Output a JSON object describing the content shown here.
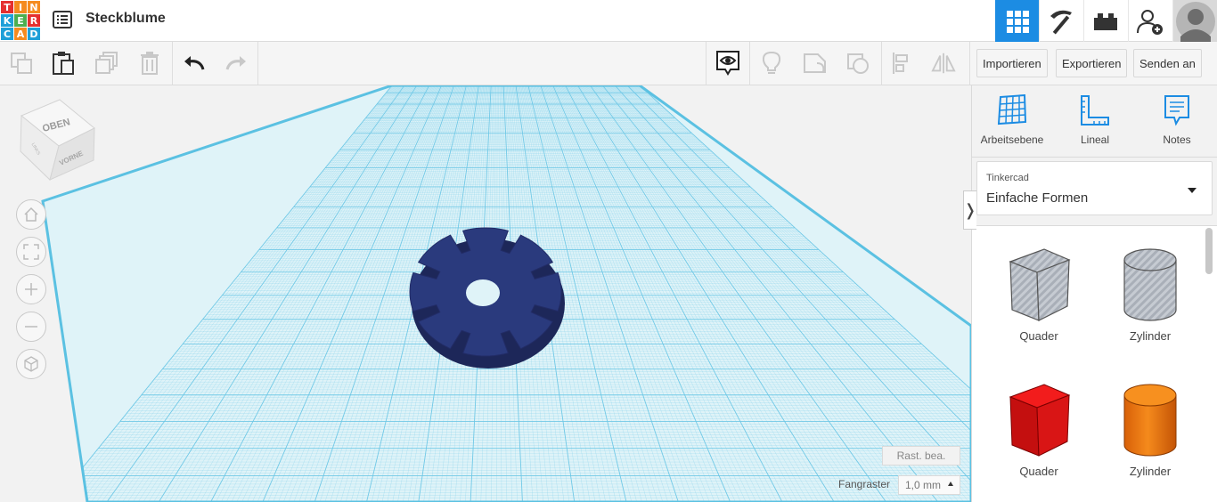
{
  "app": {
    "logo_letters": [
      "T",
      "I",
      "N",
      "K",
      "E",
      "R",
      "C",
      "A",
      "D"
    ],
    "project_title": "Steckblume"
  },
  "top_nav": {
    "views": [
      "3d-design-view",
      "build-view",
      "bricks-view"
    ],
    "active_view": "3d-design-view",
    "accent_color": "#1c8ce3"
  },
  "toolbar": {
    "import_label": "Importieren",
    "export_label": "Exportieren",
    "send_label": "Senden an",
    "undo_enabled": true,
    "redo_enabled": false
  },
  "view_cube": {
    "top_label": "OBEN",
    "front_label": "VORNE",
    "left_label": "LINKS"
  },
  "canvas": {
    "edit_grid_label": "Rast. bea.",
    "snap_grid_label": "Fangraster",
    "snap_grid_value": "1,0 mm",
    "grid_color": "#6cc7e6",
    "object_color": "#2a3a7d"
  },
  "right_panel": {
    "tools": [
      {
        "label": "Arbeitsebene",
        "icon": "workplane-icon"
      },
      {
        "label": "Lineal",
        "icon": "ruler-icon"
      },
      {
        "label": "Notes",
        "icon": "notes-icon"
      }
    ],
    "library_source": "Tinkercad",
    "library_name": "Einfache Formen",
    "shapes": [
      {
        "label": "Quader",
        "icon": "box-hole-icon",
        "color": "#b9bec6"
      },
      {
        "label": "Zylinder",
        "icon": "cylinder-hole-icon",
        "color": "#b9bec6"
      },
      {
        "label": "Quader",
        "icon": "box-icon",
        "color": "#e01e1e"
      },
      {
        "label": "Zylinder",
        "icon": "cylinder-icon",
        "color": "#ee7a12"
      }
    ]
  }
}
